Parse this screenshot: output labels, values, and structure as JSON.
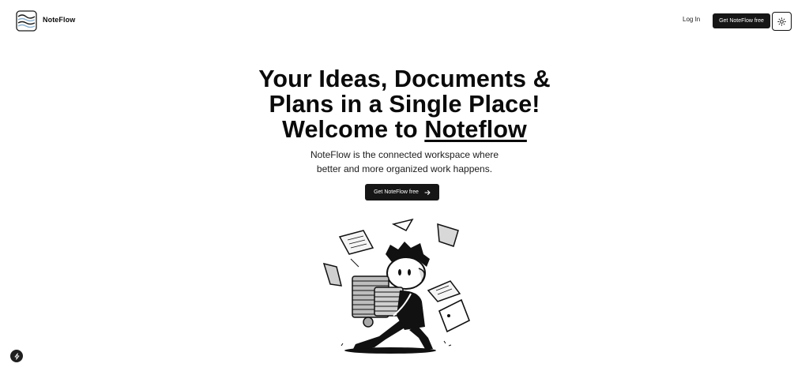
{
  "nav": {
    "brand": "NoteFlow",
    "login_label": "Log In",
    "cta_label": "Get NoteFlow free",
    "theme_toggle_icon": "sun-icon",
    "logo_icon": "waves-logo-icon"
  },
  "hero": {
    "title_line1": "Your Ideas, Documents &",
    "title_line2": "Plans in a Single Place!",
    "title_line3_prefix": "Welcome to ",
    "title_line3_brand": "Noteflow",
    "subtitle_line1": "NoteFlow is the connected workspace where",
    "subtitle_line2": "better and more organized work happens.",
    "cta_label": "Get NoteFlow free",
    "cta_icon": "arrow-right-icon"
  },
  "illustration": {
    "name": "person-carrying-documents-illustration"
  },
  "dev_indicator": {
    "icon": "lightning-icon"
  },
  "colors": {
    "background": "#ffffff",
    "button": "#161616",
    "text": "#0b0b0b"
  }
}
